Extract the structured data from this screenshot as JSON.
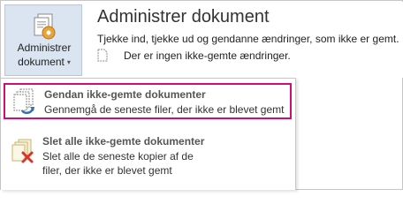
{
  "manage_button": {
    "line1": "Administrer",
    "line2": "dokument",
    "chevron": "▾",
    "icon": "manage-document-icon"
  },
  "section": {
    "title": "Administrer dokument",
    "description": "Tjekke ind, tjekke ud og gendanne ændringer, som ikke er gemt.",
    "status": "Der er ingen ikke-gemte ændringer.",
    "status_icon": "document-icon"
  },
  "menu": {
    "items": [
      {
        "title": "Gendan ikke-gemte dokumenter",
        "description": "Gennemgå de seneste filer, der ikke er blevet gemt",
        "icon": "recover-documents-icon",
        "selected": true
      },
      {
        "title": "Slet alle ikke-gemte dokumenter",
        "description": "Slet alle de seneste kopier af de filer, der ikke er blevet gemt",
        "icon": "delete-documents-icon",
        "selected": false
      }
    ]
  },
  "colors": {
    "highlight_border": "#cc0e7a",
    "button_bg": "#dbe5f1",
    "delete_x": "#d9352b",
    "recover_arrow": "#2f6fb6"
  }
}
